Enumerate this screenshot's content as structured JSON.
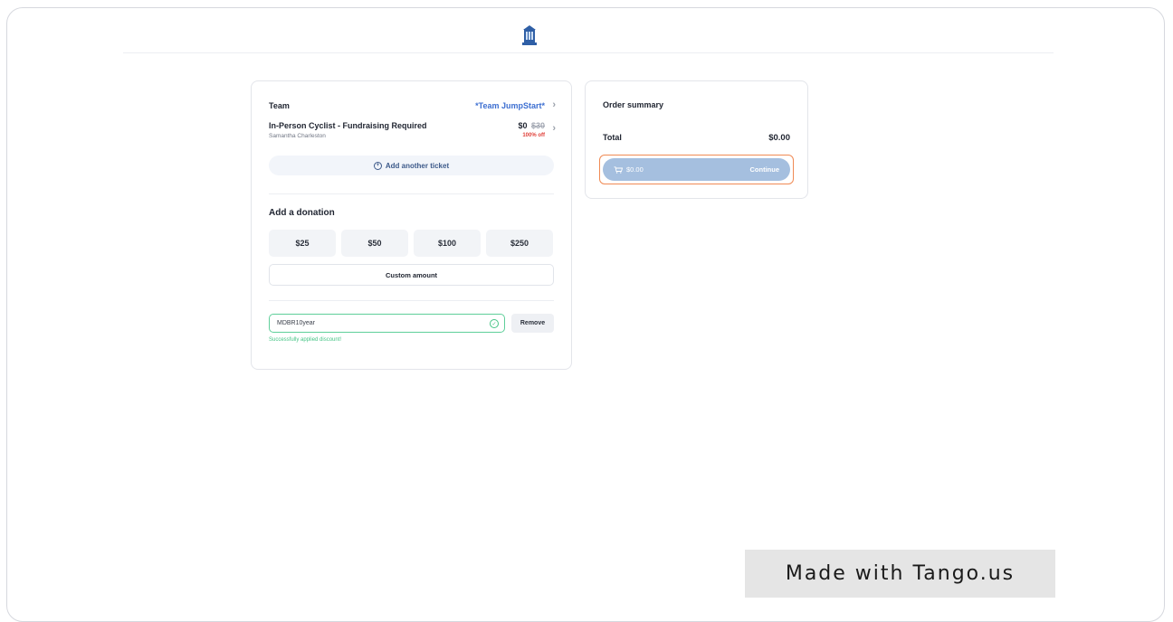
{
  "team": {
    "label": "Team",
    "value": "*Team JumpStart*"
  },
  "ticket": {
    "title": "In-Person Cyclist - Fundraising Required",
    "attendee": "Samantha Charleston",
    "price": "$0",
    "original_price": "$30",
    "discount_label": "100% off"
  },
  "add_ticket_label": "Add another ticket",
  "donation": {
    "title": "Add a donation",
    "options": [
      "$25",
      "$50",
      "$100",
      "$250"
    ],
    "custom_label": "Custom amount"
  },
  "discount_code": {
    "value": "MDBR10year",
    "remove_label": "Remove",
    "success_message": "Successfully applied discount!"
  },
  "order_summary": {
    "title": "Order summary",
    "total_label": "Total",
    "total_value": "$0.00",
    "button_amount": "$0.00",
    "button_label": "Continue"
  },
  "watermark": "Made with Tango.us",
  "colors": {
    "accent_blue": "#3d6fd1",
    "continue_button": "#a5bfdf",
    "highlight": "#f08a54",
    "success": "#45c485",
    "discount_red": "#e0413a"
  }
}
